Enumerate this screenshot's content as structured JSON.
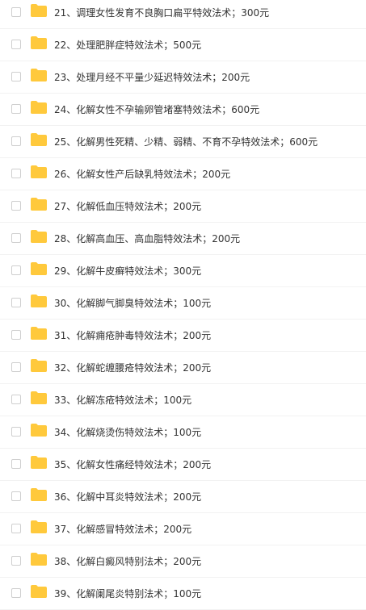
{
  "folder_color": "#ffc93c",
  "folder_icon": "folder-icon",
  "items": [
    {
      "name": "21、调理女性发育不良胸口扁平特效法术；300元"
    },
    {
      "name": "22、处理肥胖症特效法术；500元"
    },
    {
      "name": "23、处理月经不平量少延迟特效法术；200元"
    },
    {
      "name": "24、化解女性不孕输卵管堵塞特效法术；600元"
    },
    {
      "name": "25、化解男性死精、少精、弱精、不育不孕特效法术；600元"
    },
    {
      "name": "26、化解女性产后缺乳特效法术；200元"
    },
    {
      "name": "27、化解低血压特效法术；200元"
    },
    {
      "name": "28、化解高血压、高血脂特效法术；200元"
    },
    {
      "name": "29、化解牛皮癣特效法术；300元"
    },
    {
      "name": "30、化解脚气脚臭特效法术；100元"
    },
    {
      "name": "31、化解痈疮肿毒特效法术；200元"
    },
    {
      "name": "32、化解蛇缠腰疮特效法术；200元"
    },
    {
      "name": "33、化解冻疮特效法术；100元"
    },
    {
      "name": "34、化解烧烫伤特效法术；100元"
    },
    {
      "name": "35、化解女性痛经特效法术；200元"
    },
    {
      "name": "36、化解中耳炎特效法术；200元"
    },
    {
      "name": "37、化解感冒特效法术；200元"
    },
    {
      "name": "38、化解白癜风特别法术；200元"
    },
    {
      "name": "39、化解阑尾炎特别法术；100元"
    }
  ]
}
